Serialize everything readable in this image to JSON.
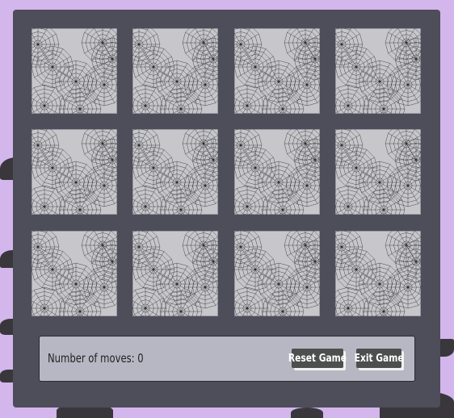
{
  "game": {
    "cards": [
      {
        "face": "hidden"
      },
      {
        "face": "hidden"
      },
      {
        "face": "hidden"
      },
      {
        "face": "hidden"
      },
      {
        "face": "hidden"
      },
      {
        "face": "hidden"
      },
      {
        "face": "hidden"
      },
      {
        "face": "hidden"
      },
      {
        "face": "hidden"
      },
      {
        "face": "hidden"
      },
      {
        "face": "hidden"
      },
      {
        "face": "hidden"
      }
    ]
  },
  "status": {
    "moves_text": "Number of moves: 0",
    "reset_label": "Reset Game",
    "exit_label": "Exit Game"
  },
  "colors": {
    "background": "#d3b6ec",
    "board": "#4e4d5a",
    "status_panel": "#b7b7c4",
    "button": "#4c4f4d"
  }
}
